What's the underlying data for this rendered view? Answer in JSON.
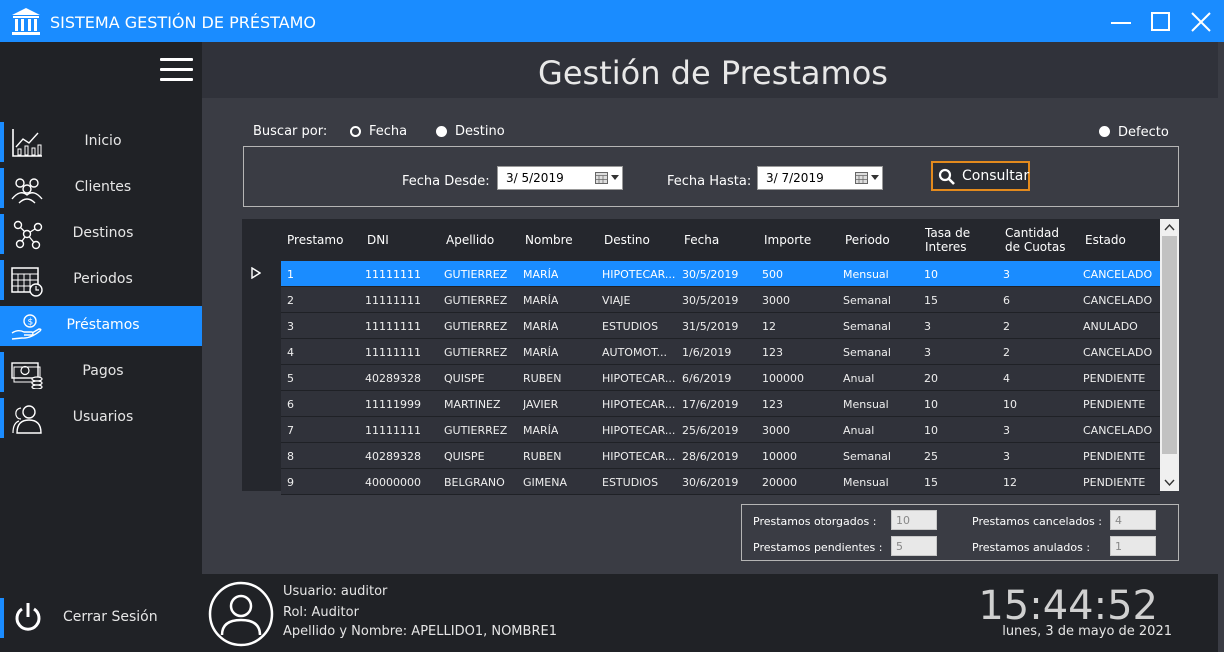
{
  "window": {
    "title": "SISTEMA GESTIÓN DE PRÉSTAMO"
  },
  "sidebar": {
    "items": [
      {
        "label": "Inicio",
        "icon": "chart-icon"
      },
      {
        "label": "Clientes",
        "icon": "clients-icon"
      },
      {
        "label": "Destinos",
        "icon": "network-icon"
      },
      {
        "label": "Periodos",
        "icon": "calendar-icon"
      },
      {
        "label": "Préstamos",
        "icon": "money-hand-icon",
        "active": true
      },
      {
        "label": "Pagos",
        "icon": "cash-icon"
      },
      {
        "label": "Usuarios",
        "icon": "users-icon"
      }
    ],
    "logout_label": "Cerrar Sesión"
  },
  "main": {
    "title": "Gestión de Prestamos",
    "search": {
      "label": "Buscar por:",
      "options": [
        "Fecha",
        "Destino",
        "Defecto"
      ],
      "from_label": "Fecha Desde:",
      "from_value": "3/  5/2019",
      "to_label": "Fecha Hasta:",
      "to_value": "3/  7/2019",
      "button": "Consultar"
    },
    "table": {
      "columns": [
        "Prestamo",
        "DNI",
        "Apellido",
        "Nombre",
        "Destino",
        "Fecha",
        "Importe",
        "Periodo",
        "Tasa de Interes",
        "Cantidad de Cuotas",
        "Estado"
      ],
      "rows": [
        [
          "1",
          "11111111",
          "GUTIERREZ",
          "MARÍA",
          "HIPOTECAR...",
          "30/5/2019",
          "500",
          "Mensual",
          "10",
          "3",
          "CANCELADO"
        ],
        [
          "2",
          "11111111",
          "GUTIERREZ",
          "MARÍA",
          "VIAJE",
          "30/5/2019",
          "3000",
          "Semanal",
          "15",
          "6",
          "CANCELADO"
        ],
        [
          "3",
          "11111111",
          "GUTIERREZ",
          "MARÍA",
          "ESTUDIOS",
          "31/5/2019",
          "12",
          "Semanal",
          "3",
          "2",
          "ANULADO"
        ],
        [
          "4",
          "11111111",
          "GUTIERREZ",
          "MARÍA",
          "AUTOMOT...",
          "1/6/2019",
          "123",
          "Semanal",
          "3",
          "2",
          "CANCELADO"
        ],
        [
          "5",
          "40289328",
          "QUISPE",
          "RUBEN",
          "HIPOTECAR...",
          "6/6/2019",
          "100000",
          "Anual",
          "20",
          "4",
          "PENDIENTE"
        ],
        [
          "6",
          "11111999",
          "MARTINEZ",
          "JAVIER",
          "HIPOTECAR...",
          "17/6/2019",
          "123",
          "Mensual",
          "10",
          "10",
          "PENDIENTE"
        ],
        [
          "7",
          "11111111",
          "GUTIERREZ",
          "MARÍA",
          "HIPOTECAR...",
          "25/6/2019",
          "3000",
          "Anual",
          "10",
          "3",
          "CANCELADO"
        ],
        [
          "8",
          "40289328",
          "QUISPE",
          "RUBEN",
          "HIPOTECAR...",
          "28/6/2019",
          "10000",
          "Semanal",
          "25",
          "3",
          "PENDIENTE"
        ],
        [
          "9",
          "40000000",
          "BELGRANO",
          "GIMENA",
          "ESTUDIOS",
          "30/6/2019",
          "20000",
          "Mensual",
          "15",
          "12",
          "PENDIENTE"
        ]
      ]
    },
    "stats": {
      "otorgados_label": "Prestamos otorgados :",
      "otorgados": "10",
      "cancelados_label": "Prestamos cancelados :",
      "cancelados": "4",
      "pendientes_label": "Prestamos pendientes :",
      "pendientes": "5",
      "anulados_label": "Prestamos anulados :",
      "anulados": "1"
    }
  },
  "footer": {
    "user": "Usuario: auditor",
    "role": "Rol: Auditor",
    "name": "Apellido y Nombre: APELLIDO1, NOMBRE1",
    "time": "15:44:52",
    "date": "lunes, 3 de mayo de 2021"
  },
  "colors": {
    "accent": "#1a8cff",
    "button_border": "#e38a1d",
    "sidebar": "#202226",
    "main": "#3a3c44"
  }
}
